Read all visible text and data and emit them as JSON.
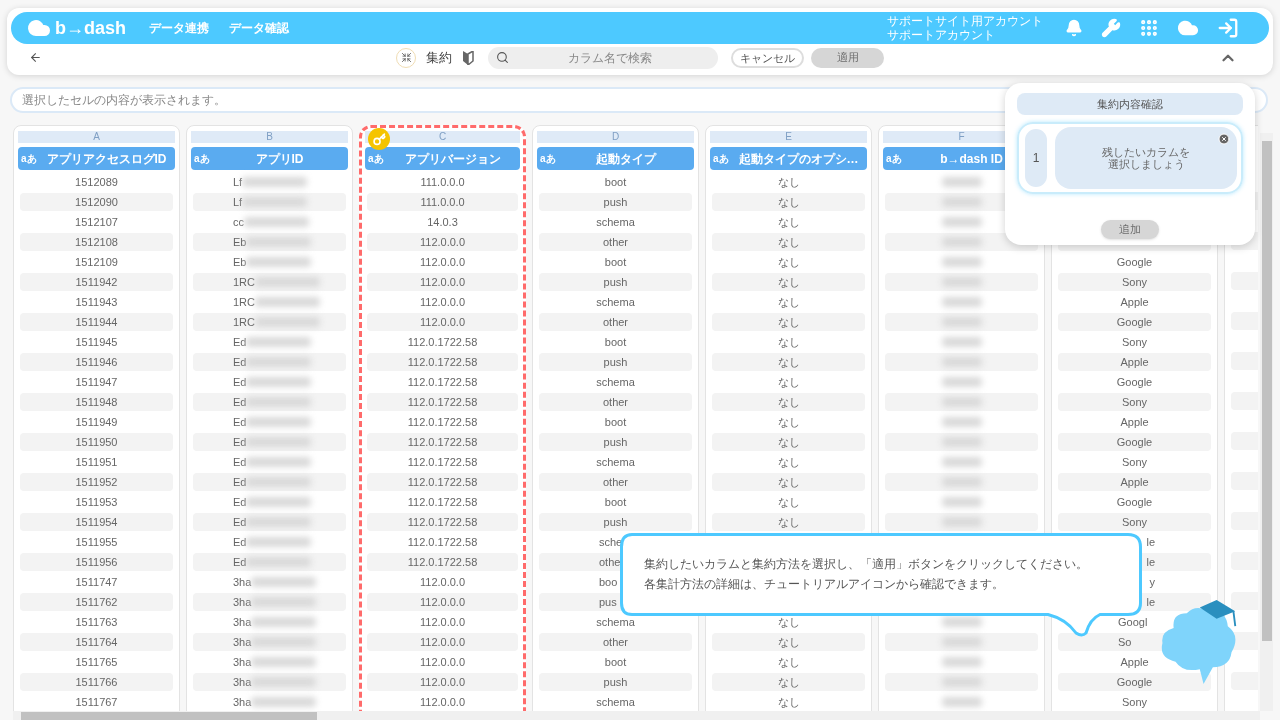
{
  "header": {
    "logo": "b→dash",
    "nav": [
      "データ連携",
      "データ確認"
    ],
    "account": [
      "サポートサイト用アカウント",
      "サポートアカウント"
    ]
  },
  "toolbar": {
    "title": "集約",
    "search_placeholder": "カラム名で検索",
    "cancel": "キャンセル",
    "apply": {
      "label": "適用",
      "disabled": true
    }
  },
  "cell_display": {
    "placeholder": "選択したセルの内容が表示されます。"
  },
  "columns": [
    {
      "letter": "A",
      "title": "アプリアクセスログID",
      "type_badge": "aあ",
      "selected": false,
      "key": false,
      "masked": false,
      "cells": [
        "1512089",
        "1512090",
        "1512107",
        "1512108",
        "1512109",
        "1511942",
        "1511943",
        "1511944",
        "1511945",
        "1511946",
        "1511947",
        "1511948",
        "1511949",
        "1511950",
        "1511951",
        "1511952",
        "1511953",
        "1511954",
        "1511955",
        "1511956",
        "1511747",
        "1511762",
        "1511763",
        "1511764",
        "1511765",
        "1511766",
        "1511767"
      ]
    },
    {
      "letter": "B",
      "title": "アプリID",
      "type_badge": "aあ",
      "selected": false,
      "key": false,
      "masked": true,
      "cells": [
        "Lf",
        "Lf",
        "cc",
        "Eb",
        "Eb",
        "1RC",
        "1RC",
        "1RC",
        "Ed",
        "Ed",
        "Ed",
        "Ed",
        "Ed",
        "Ed",
        "Ed",
        "Ed",
        "Ed",
        "Ed",
        "Ed",
        "Ed",
        "3ha",
        "3ha",
        "3ha",
        "3ha",
        "3ha",
        "3ha",
        "3ha"
      ]
    },
    {
      "letter": "C",
      "title": "アプリバージョン",
      "type_badge": "aあ",
      "selected": true,
      "key": true,
      "masked": false,
      "cells": [
        "111.0.0.0",
        "111.0.0.0",
        "14.0.3",
        "112.0.0.0",
        "112.0.0.0",
        "112.0.0.0",
        "112.0.0.0",
        "112.0.0.0",
        "112.0.1722.58",
        "112.0.1722.58",
        "112.0.1722.58",
        "112.0.1722.58",
        "112.0.1722.58",
        "112.0.1722.58",
        "112.0.1722.58",
        "112.0.1722.58",
        "112.0.1722.58",
        "112.0.1722.58",
        "112.0.1722.58",
        "112.0.1722.58",
        "112.0.0.0",
        "112.0.0.0",
        "112.0.0.0",
        "112.0.0.0",
        "112.0.0.0",
        "112.0.0.0",
        "112.0.0.0"
      ]
    },
    {
      "letter": "D",
      "title": "起動タイプ",
      "type_badge": "aあ",
      "selected": false,
      "key": false,
      "masked": false,
      "cells": [
        "boot",
        "push",
        "schema",
        "other",
        "boot",
        "push",
        "schema",
        "other",
        "boot",
        "push",
        "schema",
        "other",
        "boot",
        "push",
        "schema",
        "other",
        "boot",
        "push",
        {
          "text": "sche",
          "kind": "head"
        },
        {
          "text": "othe",
          "kind": "head"
        },
        {
          "text": "boo",
          "kind": "head"
        },
        {
          "text": "pus",
          "kind": "head"
        },
        "schema",
        "other",
        "boot",
        "push",
        "schema"
      ]
    },
    {
      "letter": "E",
      "title": "起動タイプのオプシ…",
      "type_badge": "aあ",
      "selected": false,
      "key": false,
      "masked": false,
      "cells": [
        "なし",
        "なし",
        "なし",
        "なし",
        "なし",
        "なし",
        "なし",
        "なし",
        "なし",
        "なし",
        "なし",
        "なし",
        "なし",
        "なし",
        "なし",
        "なし",
        "なし",
        "なし",
        null,
        null,
        null,
        null,
        "なし",
        "なし",
        "なし",
        "なし",
        "なし"
      ]
    },
    {
      "letter": "F",
      "title": "b→dash ID",
      "type_badge": "aあ",
      "selected": false,
      "key": false,
      "cells": [
        {
          "kind": "blurred"
        },
        {
          "kind": "blurred"
        },
        {
          "kind": "blurred"
        },
        {
          "kind": "blurred"
        },
        {
          "kind": "blurred"
        },
        {
          "kind": "blurred"
        },
        {
          "kind": "blurred"
        },
        {
          "kind": "blurred"
        },
        {
          "kind": "blurred"
        },
        {
          "kind": "blurred"
        },
        {
          "kind": "blurred"
        },
        {
          "kind": "blurred"
        },
        {
          "kind": "blurred"
        },
        {
          "kind": "blurred"
        },
        {
          "kind": "blurred"
        },
        {
          "kind": "blurred"
        },
        {
          "kind": "blurred"
        },
        {
          "kind": "blurred"
        },
        null,
        null,
        null,
        null,
        {
          "kind": "blurred"
        },
        {
          "kind": "blurred"
        },
        {
          "kind": "blurred"
        },
        {
          "kind": "blurred"
        },
        {
          "kind": "blurred"
        }
      ]
    },
    {
      "selected": false,
      "key": false,
      "masked": false,
      "cells": [
        null,
        null,
        null,
        null,
        "Google",
        "Sony",
        "Apple",
        "Google",
        "Sony",
        "Apple",
        "Google",
        "Sony",
        "Apple",
        "Google",
        "Sony",
        "Apple",
        "Google",
        "Sony",
        {
          "text": "le",
          "kind": "tail"
        },
        {
          "text": "le",
          "kind": "tail"
        },
        {
          "text": "y",
          "kind": "tail"
        },
        {
          "text": "le",
          "kind": "tail"
        },
        {
          "text": "Googl",
          "kind": "head"
        },
        {
          "text": "So",
          "kind": "head"
        },
        "Apple",
        "Google",
        "Sony"
      ]
    }
  ],
  "summary_panel": {
    "title": "集約内容確認",
    "items": [
      {
        "number": "1",
        "lines": [
          "残したいカラムを",
          "選択しましょう"
        ]
      }
    ],
    "add": {
      "label": "追加",
      "disabled": true
    }
  },
  "tooltip": {
    "lines": [
      "集約したいカラムと集約方法を選択し、「適用」ボタンをクリックしてください。",
      "各集計方法の詳細は、チュートリアルアイコンから確認できます。"
    ]
  }
}
